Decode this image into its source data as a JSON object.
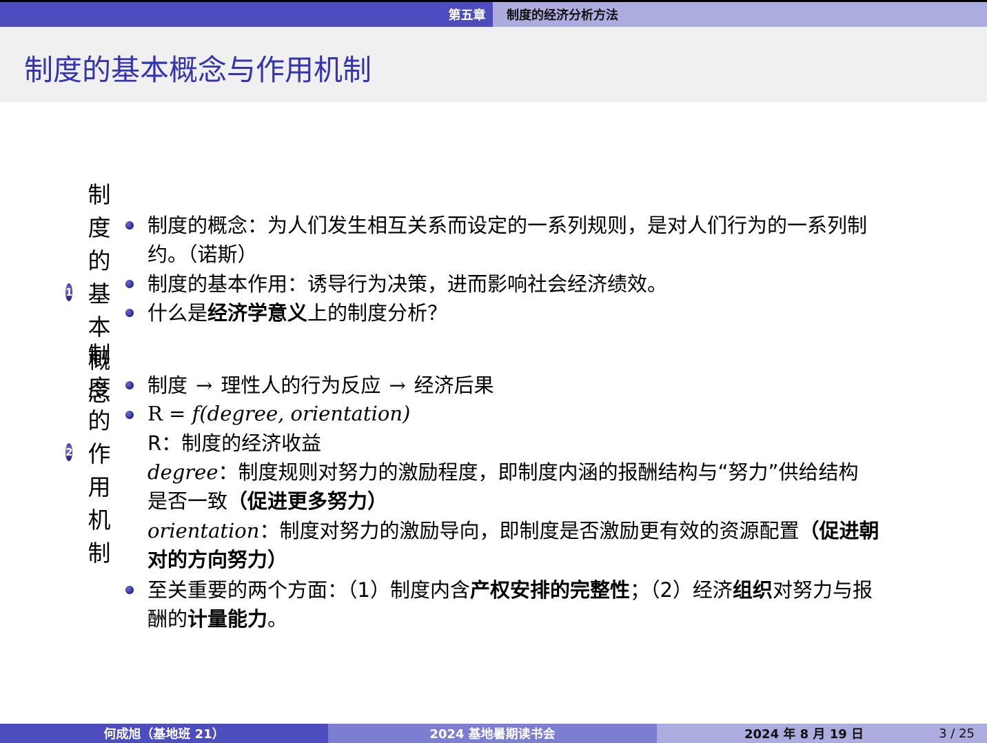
{
  "header": {
    "section": "第五章",
    "subsection": "制度的经济分析方法"
  },
  "title": "制度的基本概念与作用机制",
  "items": [
    {
      "num": "1",
      "heading": "制度的基本概念",
      "b1_l1": "制度的概念：为人们发生相互关系而设定的一系列规则，是对人们行为的一系列制",
      "b1_l2": "约。（诺斯）",
      "b2": "制度的基本作用：诱导行为决策，进而影响社会经济绩效。",
      "b3_pre": "什么是",
      "b3_bold": "经济学意义",
      "b3_post": "上的制度分析？"
    },
    {
      "num": "2",
      "heading": "制度的作用机制",
      "c1_a": "制度",
      "c1_arrow": "→",
      "c1_b": "理性人的行为反应",
      "c1_c": "经济后果",
      "formula_R": "R",
      "formula_eq": " = ",
      "formula_f": "f",
      "formula_args": "(degree, orientation)",
      "r_def": "R：制度的经济收益",
      "degree_term": "degree",
      "degree_l1": "：制度规则对努力的激励程度，即制度内涵的报酬结构与“努力”供给结构",
      "degree_l2_pre": "是否一致",
      "degree_l2_bold": "（促进更多努力）",
      "orient_term": "orientation",
      "orient_l1": "：制度对努力的激励导向，即制度是否激励更有效的资源配置",
      "orient_l1_bold": "（促进朝",
      "orient_l2_bold": "对的方向努力）",
      "c3_a": "至关重要的两个方面：（1）制度内含",
      "c3_b": "产权安排的完整性",
      "c3_c": "；（2）经济",
      "c3_d": "组织",
      "c3_e": "对努力与报",
      "c3_l2_a": "酬的",
      "c3_l2_b": "计量能力",
      "c3_l2_c": "。"
    }
  ],
  "footer": {
    "author": "何成旭（基地班 21）",
    "event": "2024 基地暑期读书会",
    "date": "2024 年 8 月 19 日",
    "page": "3 / 25"
  },
  "colors": {
    "primary": "#4d4dbf",
    "light": "#acacdf",
    "mid": "#7d7dd1",
    "title": "#3333b3"
  }
}
